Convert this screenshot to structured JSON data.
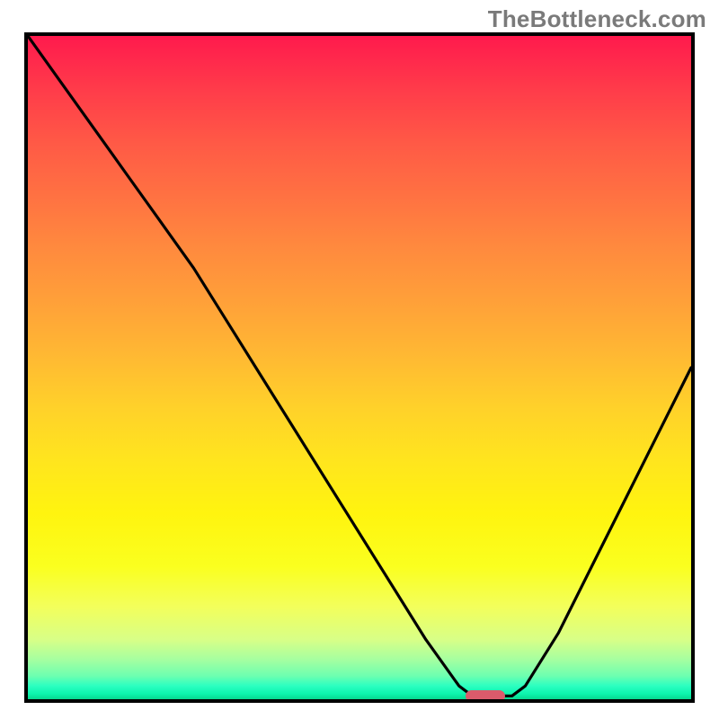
{
  "watermark": "TheBottleneck.com",
  "chart_data": {
    "type": "line",
    "title": "",
    "xlabel": "",
    "ylabel": "",
    "xlim": [
      0,
      100
    ],
    "ylim": [
      0,
      100
    ],
    "grid": false,
    "legend": false,
    "series": [
      {
        "name": "curve",
        "x": [
          0,
          5,
          10,
          15,
          20,
          25,
          30,
          35,
          40,
          45,
          50,
          55,
          60,
          65,
          67,
          70,
          73,
          75,
          80,
          85,
          90,
          95,
          100
        ],
        "values": [
          100,
          93,
          86,
          79,
          72,
          65,
          57,
          49,
          41,
          33,
          25,
          17,
          9,
          2,
          0.5,
          0.5,
          0.5,
          2,
          10,
          20,
          30,
          40,
          50
        ]
      }
    ],
    "annotations": {
      "marker": {
        "x_center": 69,
        "y": 0.5,
        "width_pct": 6
      }
    },
    "background": "vertical-gradient-red-to-green"
  },
  "colors": {
    "curve": "#000000",
    "frame": "#000000",
    "marker": "#db5b6b",
    "watermark": "#7a7a7a"
  }
}
